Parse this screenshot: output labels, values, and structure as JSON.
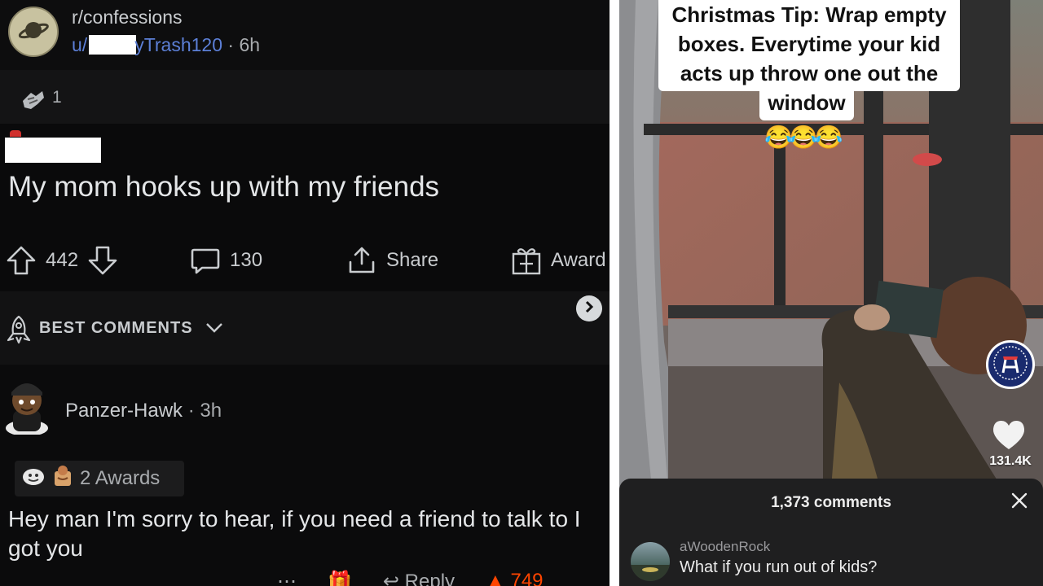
{
  "reddit": {
    "subreddit": "r/confessions",
    "user_prefix": "u/",
    "user_suffix": "yTrash120",
    "post_age": "6h",
    "award_count": "1",
    "post_title": "My mom hooks up with my friends",
    "votes": "442",
    "comments": "130",
    "share_label": "Share",
    "award_label": "Award",
    "sort_label": "BEST COMMENTS",
    "comment": {
      "username": "Panzer-Hawk",
      "age": "3h",
      "awards_label": "2 Awards",
      "body": "Hey man I'm sorry to hear, if you need a friend to talk to I got you",
      "reply_label": "Reply",
      "votes": "749"
    },
    "separator": "·"
  },
  "tiktok": {
    "caption_main": "Christmas Tip: Wrap empty boxes. Everytime your kid acts up throw one out the",
    "caption_last": "window",
    "emojis": "😂😂😂",
    "likes": "131.4K",
    "comments_count": "1,373 comments",
    "top_comment": {
      "username": "aWoodenRock",
      "text": "What if you run out of kids?"
    }
  },
  "colors": {
    "reddit_bg": "#0a0a0b",
    "reddit_username": "#5c7fd6",
    "upvote_orange": "#ff4500",
    "tiktok_sheet": "#1f1f20",
    "barstool_blue": "#1a2b6e"
  },
  "icons": [
    "planet-icon",
    "award-icon",
    "upvote-icon",
    "downvote-icon",
    "comment-icon",
    "share-icon",
    "gift-icon",
    "rocket-icon",
    "chevron-down-icon",
    "chevron-right-icon",
    "heart-icon",
    "close-icon",
    "reply-icon"
  ]
}
